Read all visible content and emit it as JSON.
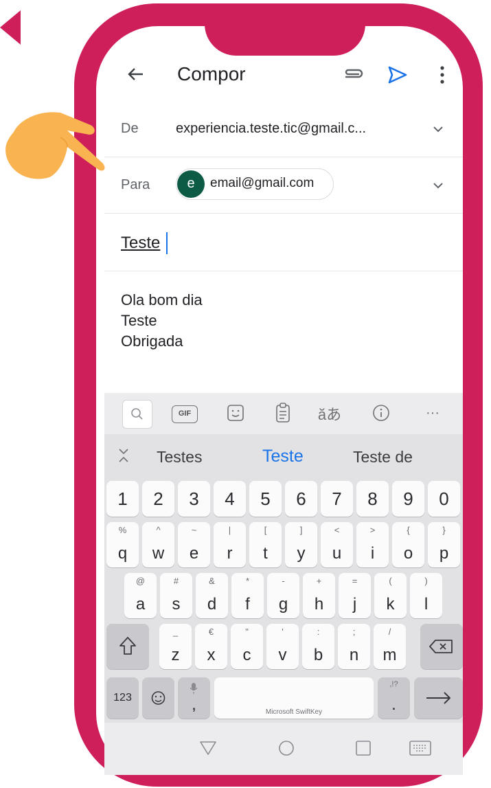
{
  "header": {
    "title": "Compor"
  },
  "from": {
    "label": "De",
    "value": "experiencia.teste.tic@gmail.c..."
  },
  "to": {
    "label": "Para",
    "avatar_letter": "e",
    "value": "email@gmail.com"
  },
  "subject": "Teste",
  "body_lines": [
    "Ola bom dia",
    "Teste",
    "Obrigada"
  ],
  "keyboard": {
    "gif_label": "GIF",
    "suggestions": [
      "Testes",
      "Teste",
      "Teste de"
    ],
    "num_row": [
      "1",
      "2",
      "3",
      "4",
      "5",
      "6",
      "7",
      "8",
      "9",
      "0"
    ],
    "row1": [
      [
        "%",
        "q"
      ],
      [
        "^",
        "w"
      ],
      [
        "~",
        "e"
      ],
      [
        "|",
        "r"
      ],
      [
        "[",
        "t"
      ],
      [
        "]",
        "y"
      ],
      [
        "<",
        "u"
      ],
      [
        ">",
        "i"
      ],
      [
        "{",
        "o"
      ],
      [
        "}",
        "p"
      ]
    ],
    "row2": [
      [
        "@",
        "a"
      ],
      [
        "#",
        "s"
      ],
      [
        "&",
        "d"
      ],
      [
        "*",
        "f"
      ],
      [
        "-",
        "g"
      ],
      [
        "+",
        "h"
      ],
      [
        "=",
        "j"
      ],
      [
        "(",
        "k"
      ],
      [
        ")",
        "l"
      ]
    ],
    "row3": [
      [
        "_",
        "z"
      ],
      [
        "€",
        "x"
      ],
      [
        "\"",
        "c"
      ],
      [
        "'",
        "v"
      ],
      [
        ":",
        "b"
      ],
      [
        ";",
        "n"
      ],
      [
        "/",
        "m"
      ]
    ],
    "numbers_key": "123",
    "comma_key": ",",
    "space_label": "Microsoft SwiftKey",
    "period_key": ".",
    "period_sub": ",!?"
  },
  "colors": {
    "frame": "#cf1f5b",
    "accent": "#1a73e8",
    "avatar": "#0d5b45",
    "hand": "#f9b451"
  }
}
